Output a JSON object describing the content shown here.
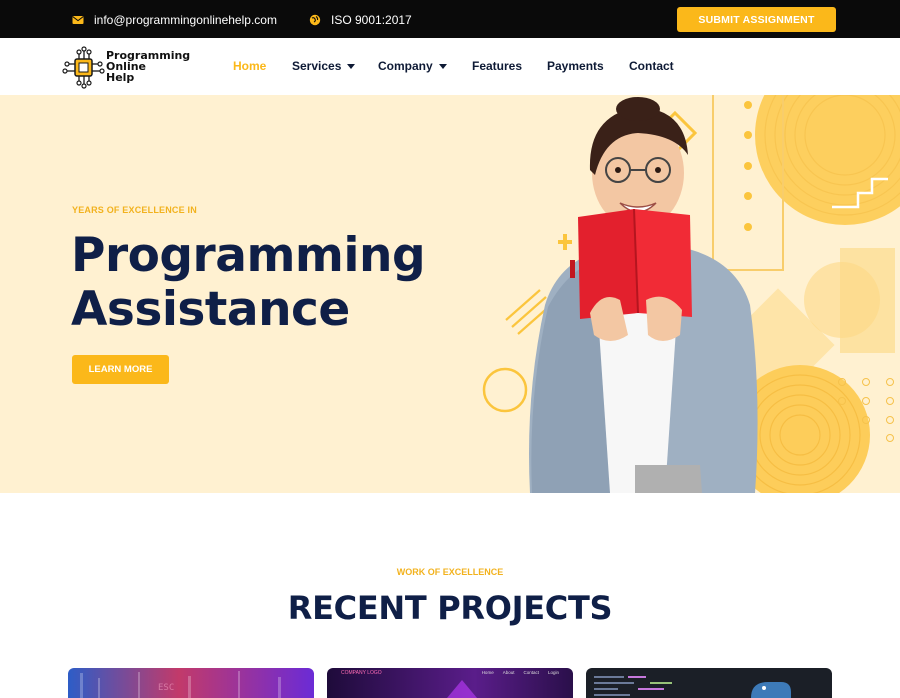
{
  "topbar": {
    "email": "info@programmingonlinehelp.com",
    "iso": "ISO 9001:2017",
    "submit_label": "SUBMIT ASSIGNMENT",
    "email_icon": "envelope-icon",
    "iso_icon": "globe-icon"
  },
  "nav": {
    "logo_lines": [
      "Programming",
      "Online",
      "Help"
    ],
    "items": [
      {
        "label": "Home",
        "active": true
      },
      {
        "label": "Services",
        "dropdown": true
      },
      {
        "label": "Company",
        "dropdown": true
      },
      {
        "label": "Features"
      },
      {
        "label": "Payments"
      },
      {
        "label": "Contact"
      }
    ]
  },
  "hero": {
    "eyebrow": "YEARS OF EXCELLENCE IN",
    "title_line1": "Programming",
    "title_line2": "Assistance",
    "cta": "LEARN MORE"
  },
  "projects": {
    "eyebrow": "WORK OF EXCELLENCE",
    "title": "RECENT PROJECTS",
    "card2_label": "COMPANY LOGO",
    "card2_nav": [
      "Home",
      "About",
      "Contact",
      "Login"
    ]
  },
  "colors": {
    "accent": "#fbb81a",
    "navy": "#0f1f47",
    "hero_bg": "#fff1d1",
    "topbar_bg": "#0a0a0a"
  }
}
